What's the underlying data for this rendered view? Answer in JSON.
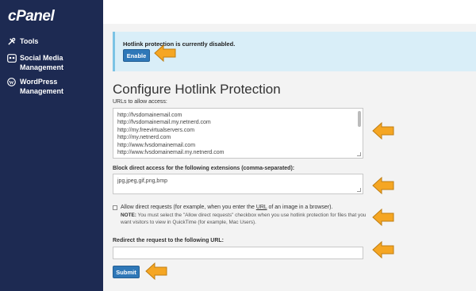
{
  "sidebar": {
    "logo": "cPanel",
    "items": [
      {
        "label": "Tools",
        "icon": "tools-icon"
      },
      {
        "label": "Social Media Management",
        "line1": "Social Media",
        "line2": "Management",
        "icon": "social-icon"
      },
      {
        "label": "WordPress Management",
        "line1": "WordPress",
        "line2": "Management",
        "icon": "wordpress-icon"
      }
    ]
  },
  "alert": {
    "text": "Hotlink protection is currently disabled.",
    "enable_label": "Enable"
  },
  "page_title": "Configure Hotlink Protection",
  "urls": {
    "label": "URLs to allow access:",
    "lines": [
      "http://fvsdomainemail.com",
      "http://fvsdomainemail.my.netnerd.com",
      "http://my.freevirtualservers.com",
      "http://my.netnerd.com",
      "http://www.fvsdomainemail.com",
      "http://www.fvsdomainemail.my.netnerd.com"
    ]
  },
  "extensions": {
    "label": "Block direct access for the following extensions (comma-separated):",
    "value": "jpg,jpeg,gif,png,bmp"
  },
  "direct_requests": {
    "label_pre": "Allow direct requests (for example, when you enter the ",
    "label_url": "URL",
    "label_post": " of an image in a browser).",
    "note_prefix": "NOTE:",
    "note_text": " You must select the \"Allow direct requests\" checkbox when you use hotlink protection for files that you want visitors to view in QuickTime (for example, Mac Users).",
    "checked": false
  },
  "redirect": {
    "label": "Redirect the request to the following URL:",
    "value": ""
  },
  "submit_label": "Submit",
  "colors": {
    "sidebar": "#1d2a52",
    "button": "#2f78b8",
    "alert_bg": "#d9eef8",
    "arrow": "#f5a623"
  }
}
